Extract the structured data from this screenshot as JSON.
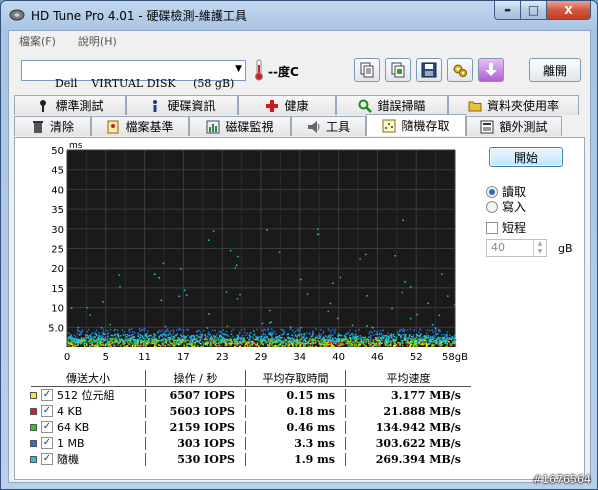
{
  "window": {
    "title": "HD Tune Pro 4.01 - 硬碟檢測-維護工具",
    "minimize_glyph": "▬",
    "maximize_glyph": "□",
    "close_glyph": "X"
  },
  "menu": {
    "items": [
      "檔案(F)",
      "說明(H)"
    ]
  },
  "toolbar": {
    "drive": "Dell    VIRTUAL DISK     (58 gB)",
    "temperature": "--度C",
    "icons": [
      "copy-text-icon",
      "copy-screenshot-icon",
      "save-icon",
      "options-icon",
      "download-icon"
    ],
    "exit_label": "離開"
  },
  "tabs": {
    "row1": [
      {
        "label": "標準測試",
        "icon": "benchmark-icon"
      },
      {
        "label": "硬碟資訊",
        "icon": "info-icon"
      },
      {
        "label": "健康",
        "icon": "health-icon"
      },
      {
        "label": "錯誤掃瞄",
        "icon": "error-scan-icon"
      },
      {
        "label": "資料夾使用率",
        "icon": "folder-usage-icon"
      }
    ],
    "row2": [
      {
        "label": "清除",
        "icon": "erase-icon"
      },
      {
        "label": "檔案基準",
        "icon": "file-benchmark-icon"
      },
      {
        "label": "磁碟監視",
        "icon": "disk-monitor-icon"
      },
      {
        "label": "工具",
        "icon": "tools-icon"
      },
      {
        "label": "隨機存取",
        "icon": "random-access-icon",
        "active": true
      },
      {
        "label": "額外測試",
        "icon": "extra-tests-icon"
      }
    ]
  },
  "controls": {
    "start_label": "開始",
    "read_label": "讀取",
    "write_label": "寫入",
    "mode_selected": "read",
    "short_label": "短程",
    "short_checked": false,
    "short_value": "40",
    "short_unit": "gB"
  },
  "chart_data": {
    "type": "scatter",
    "y_unit_label": "ms",
    "y_ticks": [
      "50",
      "45",
      "40",
      "35",
      "30",
      "25",
      "20",
      "15",
      "10",
      "5.0"
    ],
    "x_ticks": [
      "0",
      "5",
      "11",
      "17",
      "23",
      "29",
      "34",
      "40",
      "46",
      "52",
      "58gB"
    ],
    "xlim": [
      0,
      58
    ],
    "ylim": [
      0,
      50
    ],
    "grid": true,
    "background": "#1a1a1a",
    "series": [
      {
        "color": "#e8e800",
        "band": [
          0.3,
          2.2
        ],
        "density": 0.9
      },
      {
        "color": "#d42020",
        "band": [
          0.3,
          2.0
        ],
        "density": 0.2
      },
      {
        "color": "#2ec82e",
        "band": [
          0.4,
          2.6
        ],
        "density": 0.6
      },
      {
        "color": "#2a6fd8",
        "band": [
          1.5,
          4.8
        ],
        "density": 0.7
      },
      {
        "color": "#22c8d8",
        "band": [
          1.0,
          3.5
        ],
        "density": 0.8
      }
    ],
    "outlier_color": "#22c8d8"
  },
  "results": {
    "headers": {
      "type": "傳送大小",
      "ops": "操作 / 秒",
      "access": "平均存取時間",
      "speed": "平均速度"
    },
    "rows": [
      {
        "color": "#f0e82a",
        "label": "512 位元組",
        "ops": "6507 IOPS",
        "access": "0.15 ms",
        "speed": "3.177 MB/s"
      },
      {
        "color": "#d42020",
        "label": "4 KB",
        "ops": "5603 IOPS",
        "access": "0.18 ms",
        "speed": "21.888 MB/s"
      },
      {
        "color": "#2ec82e",
        "label": "64 KB",
        "ops": "2159 IOPS",
        "access": "0.46 ms",
        "speed": "134.942 MB/s"
      },
      {
        "color": "#2a6fd8",
        "label": "1 MB",
        "ops": "303 IOPS",
        "access": "3.3 ms",
        "speed": "303.622 MB/s"
      },
      {
        "color": "#22c8d8",
        "label": "隨機",
        "ops": "530 IOPS",
        "access": "1.9 ms",
        "speed": "269.394 MB/s"
      }
    ]
  },
  "watermark": "#1676564"
}
